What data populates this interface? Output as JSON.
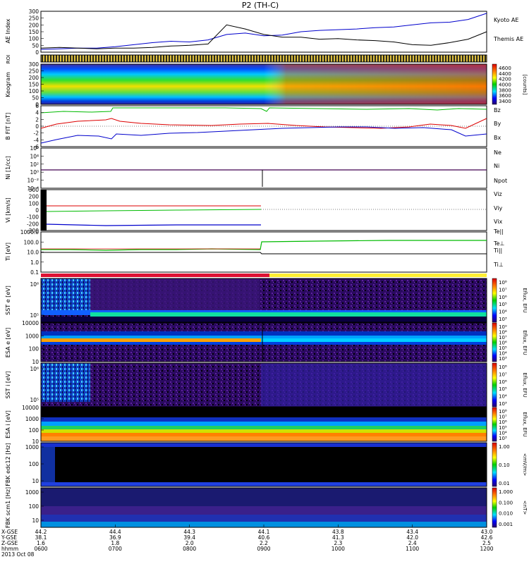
{
  "title": "P2 (TH-C)",
  "chart_data": [
    {
      "type": "line",
      "panel": "ae",
      "ylabel": "AE Index",
      "yticks": [
        "300",
        "250",
        "200",
        "150",
        "100",
        "50",
        "0"
      ],
      "ylim": [
        0,
        300
      ],
      "x": [
        "0600",
        "0615",
        "0630",
        "0645",
        "0700",
        "0715",
        "0730",
        "0745",
        "0800",
        "0815",
        "0830",
        "0845",
        "0900",
        "0915",
        "0930",
        "0945",
        "1000",
        "1015",
        "1030",
        "1045",
        "1100",
        "1115",
        "1130",
        "1145",
        "1200"
      ],
      "series": [
        {
          "name": "Kyoto AE",
          "color": "#0000cc",
          "values": [
            20,
            25,
            30,
            30,
            40,
            55,
            70,
            80,
            75,
            90,
            130,
            140,
            120,
            125,
            150,
            160,
            165,
            170,
            180,
            185,
            200,
            215,
            220,
            240,
            285
          ]
        },
        {
          "name": "Themis AE",
          "color": "#000000",
          "values": [
            30,
            35,
            30,
            25,
            30,
            30,
            35,
            45,
            50,
            60,
            200,
            170,
            130,
            110,
            110,
            95,
            100,
            90,
            85,
            75,
            55,
            50,
            70,
            95,
            150
          ]
        }
      ]
    },
    {
      "type": "strip",
      "panel": "roi",
      "ylabel": "ROI"
    },
    {
      "type": "heatmap",
      "panel": "keogram",
      "ylabel": "Keogram",
      "yticks": [
        "300",
        "250",
        "200",
        "150",
        "100",
        "50",
        "0"
      ],
      "colorbar": {
        "label": "[counts]",
        "ticks": [
          "4600",
          "4400",
          "4200",
          "4000",
          "3800",
          "3600",
          "3400"
        ]
      }
    },
    {
      "type": "line",
      "panel": "bfield",
      "ylabel": "B FIT [nT]",
      "yticks": [
        "6",
        "4",
        "2",
        "0",
        "-2",
        "-4",
        "-6"
      ],
      "series": [
        {
          "name": "Bz",
          "color": "#dd0000"
        },
        {
          "name": "By",
          "color": "#00bb00"
        },
        {
          "name": "Bx",
          "color": "#0000cc"
        }
      ]
    },
    {
      "type": "line",
      "panel": "density",
      "ylabel": "Ni [1/cc]",
      "yticks": [
        "10⁶",
        "10⁴",
        "10²",
        "10⁰",
        "10⁻²",
        "10⁻⁴"
      ],
      "series": [
        {
          "name": "Ne",
          "color": "#dd0000"
        },
        {
          "name": "Ni",
          "color": "#000000"
        },
        {
          "name": "Npot",
          "color": "#0000cc"
        }
      ]
    },
    {
      "type": "line",
      "panel": "velocity",
      "ylabel": "Vi [km/s]",
      "yticks": [
        "300",
        "200",
        "100",
        "0",
        "-100",
        "-200",
        "-300"
      ],
      "series": [
        {
          "name": "Viz",
          "color": "#dd0000"
        },
        {
          "name": "Viy",
          "color": "#00bb00"
        },
        {
          "name": "Vix",
          "color": "#0000cc"
        },
        {
          "name": "Te||",
          "color": "#000000"
        }
      ]
    },
    {
      "type": "line",
      "panel": "temperature",
      "ylabel": "Ti [eV]",
      "yticks": [
        "1000.0",
        "100.0",
        "10.0",
        "1.0",
        "0.1"
      ],
      "series": [
        {
          "name": "Te⊥",
          "color": "#dd0000"
        },
        {
          "name": "Ti||",
          "color": "#00bb00"
        },
        {
          "name": "Ti⊥",
          "color": "#0000cc"
        }
      ]
    },
    {
      "type": "heatmap",
      "panel": "sst_e",
      "ylabel": "SST e [eV]",
      "yticks": [
        "10⁶",
        "10⁵"
      ],
      "colorbar": {
        "label": "Eflux, EFU",
        "ticks": [
          "10⁸",
          "10⁷",
          "10⁶",
          "10⁵",
          "10⁴",
          "10³"
        ]
      }
    },
    {
      "type": "heatmap",
      "panel": "esa_e",
      "ylabel": "ESA e [eV]",
      "yticks": [
        "10000",
        "1000",
        "100",
        "10"
      ],
      "colorbar": {
        "label": "Eflux, EFU",
        "ticks": [
          "10⁹",
          "10⁸",
          "10⁷",
          "10⁶",
          "10⁵",
          "10⁴",
          "10³"
        ]
      }
    },
    {
      "type": "heatmap",
      "panel": "sst_i",
      "ylabel": "SST i [eV]",
      "yticks": [
        "10⁶",
        "10⁵"
      ],
      "colorbar": {
        "label": "Eflux, EFU",
        "ticks": [
          "10⁸",
          "10⁷",
          "10⁶",
          "10⁵",
          "10⁴",
          "10³"
        ]
      }
    },
    {
      "type": "heatmap",
      "panel": "esa_i",
      "ylabel": "ESA i [eV]",
      "yticks": [
        "10000",
        "1000",
        "100",
        "10"
      ],
      "colorbar": {
        "label": "Eflux, EFU",
        "ticks": [
          "10⁸",
          "10⁷",
          "10⁶",
          "10⁵",
          "10⁴",
          "10³"
        ]
      }
    },
    {
      "type": "heatmap",
      "panel": "fbk_e",
      "ylabel": "FBK edc12 [Hz]",
      "yticks": [
        "1000",
        "100",
        "10"
      ],
      "colorbar": {
        "label": "<mV/m>",
        "ticks": [
          "1.00",
          "0.10",
          "0.01"
        ]
      }
    },
    {
      "type": "heatmap",
      "panel": "fbk_b",
      "ylabel": "FBK scm1 [Hz]",
      "yticks": [
        "1000",
        "100",
        "10"
      ],
      "colorbar": {
        "label": "<nT>",
        "ticks": [
          "1.000",
          "0.100",
          "0.010",
          "0.001"
        ]
      }
    }
  ],
  "xaxis": {
    "row_labels": [
      "X-GSE",
      "Y-GSE",
      "Z-GSE",
      "hhmm",
      "2013 Oct 08"
    ],
    "columns": [
      {
        "x": "44.2",
        "y": "38.1",
        "z": "1.6",
        "t": "0600"
      },
      {
        "x": "44.4",
        "y": "36.9",
        "z": "1.8",
        "t": "0700"
      },
      {
        "x": "44.3",
        "y": "39.4",
        "z": "2.0",
        "t": "0800"
      },
      {
        "x": "44.1",
        "y": "40.6",
        "z": "2.2",
        "t": "0900"
      },
      {
        "x": "43.8",
        "y": "41.3",
        "z": "2.3",
        "t": "1000"
      },
      {
        "x": "43.4",
        "y": "42.0",
        "z": "2.4",
        "t": "1100"
      },
      {
        "x": "43.0",
        "y": "42.6",
        "z": "2.5",
        "t": "1200"
      }
    ]
  }
}
